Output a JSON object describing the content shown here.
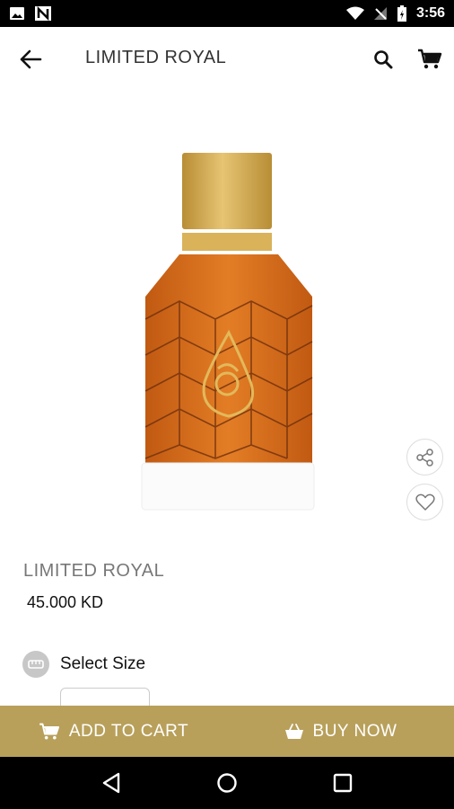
{
  "status_bar": {
    "time": "3:56",
    "icons": [
      "image-icon",
      "n-icon",
      "wifi-icon",
      "signal-off-icon",
      "battery-charging-icon"
    ]
  },
  "header": {
    "title": "LIMITED ROYAL",
    "back_icon": "arrow-left-icon",
    "search_icon": "search-icon",
    "cart_icon": "cart-icon"
  },
  "product": {
    "name": "LIMITED ROYAL",
    "price": "45.000 KD",
    "bottle_label": "LIMITED ROYAL"
  },
  "size": {
    "label": "Select Size"
  },
  "actions": {
    "add_to_cart": "ADD TO CART",
    "buy_now": "BUY NOW"
  },
  "colors": {
    "accent": "#b8a05b",
    "liquid": "#d06a1a",
    "cap": "#d4a84b"
  },
  "nav": {
    "icons": [
      "back-triangle-icon",
      "home-circle-icon",
      "recents-square-icon"
    ]
  }
}
